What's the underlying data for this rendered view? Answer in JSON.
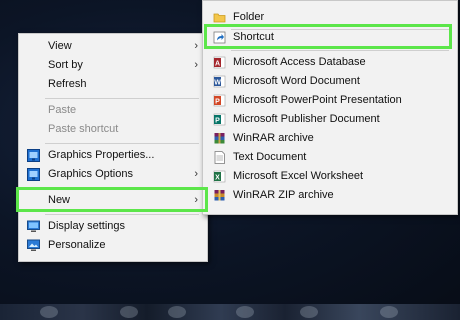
{
  "context_menu": {
    "items": [
      {
        "label": "View",
        "icon": "",
        "has_submenu": true,
        "enabled": true
      },
      {
        "label": "Sort by",
        "icon": "",
        "has_submenu": true,
        "enabled": true
      },
      {
        "label": "Refresh",
        "icon": "",
        "has_submenu": false,
        "enabled": true
      },
      {
        "label": "Paste",
        "icon": "",
        "has_submenu": false,
        "enabled": false
      },
      {
        "label": "Paste shortcut",
        "icon": "",
        "has_submenu": false,
        "enabled": false
      },
      {
        "label": "Graphics Properties...",
        "icon": "graphics-properties-icon",
        "has_submenu": false,
        "enabled": true
      },
      {
        "label": "Graphics Options",
        "icon": "graphics-options-icon",
        "has_submenu": true,
        "enabled": true
      },
      {
        "label": "New",
        "icon": "",
        "has_submenu": true,
        "enabled": true,
        "highlighted": true
      },
      {
        "label": "Display settings",
        "icon": "display-settings-icon",
        "has_submenu": false,
        "enabled": true
      },
      {
        "label": "Personalize",
        "icon": "personalize-icon",
        "has_submenu": false,
        "enabled": true
      }
    ],
    "arrow_glyph": "›"
  },
  "new_submenu": {
    "items": [
      {
        "label": "Folder",
        "icon": "folder-icon"
      },
      {
        "label": "Shortcut",
        "icon": "shortcut-icon",
        "highlighted": true
      },
      {
        "label": "Microsoft Access Database",
        "icon": "access-icon"
      },
      {
        "label": "Microsoft Word Document",
        "icon": "word-icon"
      },
      {
        "label": "Microsoft PowerPoint Presentation",
        "icon": "powerpoint-icon"
      },
      {
        "label": "Microsoft Publisher Document",
        "icon": "publisher-icon"
      },
      {
        "label": "WinRAR archive",
        "icon": "winrar-icon"
      },
      {
        "label": "Text Document",
        "icon": "text-document-icon"
      },
      {
        "label": "Microsoft Excel Worksheet",
        "icon": "excel-icon"
      },
      {
        "label": "WinRAR ZIP archive",
        "icon": "winrar-zip-icon"
      }
    ]
  },
  "colors": {
    "highlight": "#5ce64a",
    "menu_background": "#f2f2f2",
    "disabled_text": "#8a8a8a"
  }
}
